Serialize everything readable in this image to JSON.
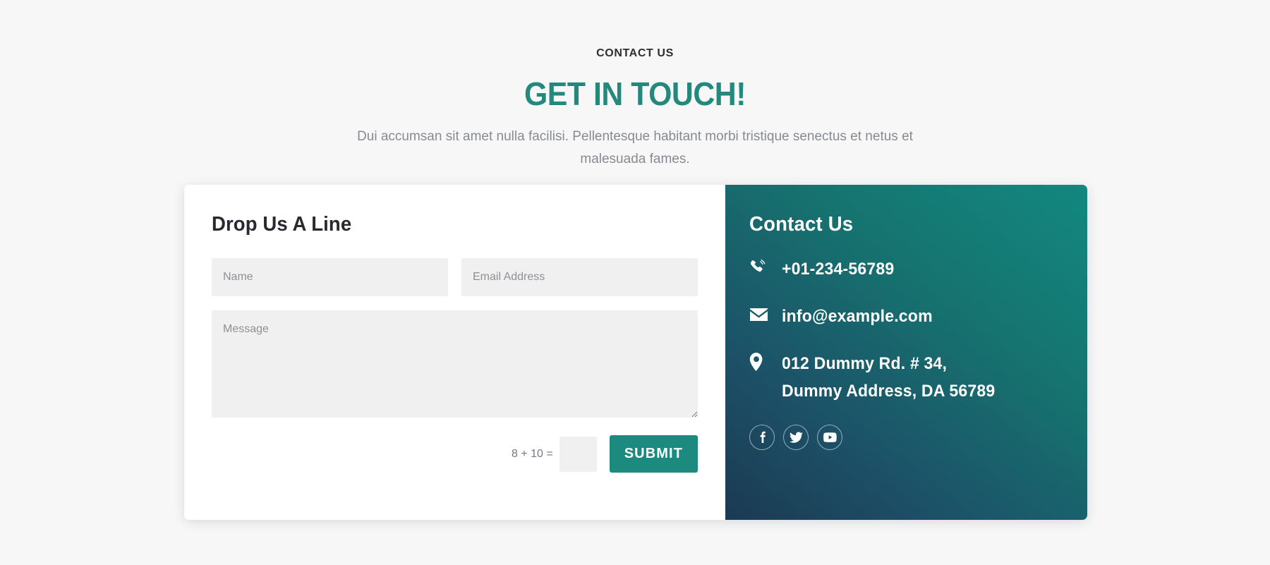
{
  "header": {
    "eyebrow": "CONTACT US",
    "headline": "GET IN TOUCH!",
    "subtitle": "Dui accumsan sit amet nulla facilisi. Pellentesque habitant morbi tristique senectus et netus et malesuada fames."
  },
  "form": {
    "title": "Drop Us A Line",
    "name_placeholder": "Name",
    "name_value": "",
    "email_placeholder": "Email Address",
    "email_value": "",
    "message_placeholder": "Message",
    "message_value": "",
    "captcha_label": "8 + 10 =",
    "captcha_value": "",
    "captcha_placeholder": "",
    "submit_label": "SUBMIT"
  },
  "info": {
    "title": "Contact Us",
    "items": [
      {
        "icon": "phone-icon",
        "text": "+01-234-56789"
      },
      {
        "icon": "envelope-icon",
        "text": "info@example.com"
      },
      {
        "icon": "map-pin-icon",
        "text": "012 Dummy Rd. # 34,\nDummy Address, DA 56789"
      }
    ],
    "socials": [
      {
        "icon": "facebook-icon",
        "label": "Facebook"
      },
      {
        "icon": "twitter-icon",
        "label": "Twitter"
      },
      {
        "icon": "youtube-icon",
        "label": "YouTube"
      }
    ]
  },
  "colors": {
    "page_background": "#f7f7f7",
    "accent_teal": "#23897d",
    "button_teal": "#1d8a80",
    "panel_gradient_start": "#12887f",
    "panel_gradient_end": "#1b3a52",
    "field_background": "#f0f0f0",
    "heading_dark": "#272a2e",
    "muted_text": "#878a90"
  }
}
